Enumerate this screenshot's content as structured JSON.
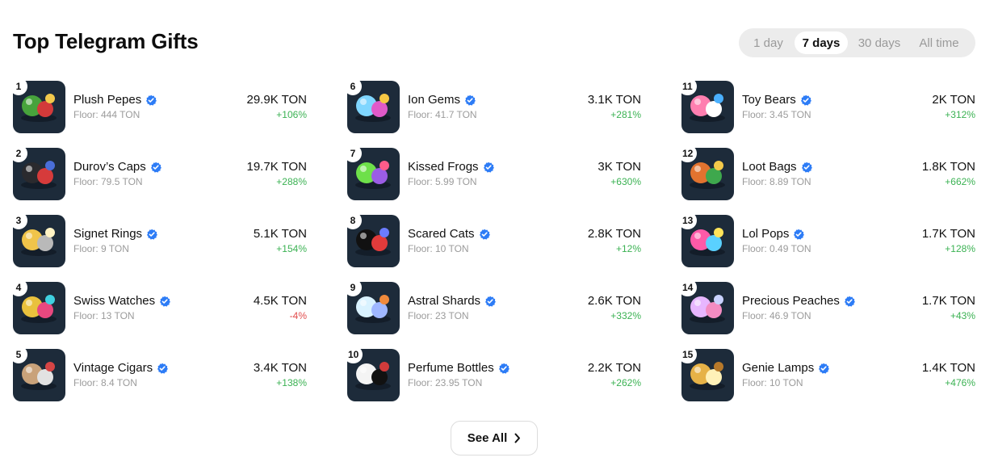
{
  "header": {
    "title": "Top Telegram Gifts"
  },
  "range": {
    "options": [
      {
        "label": "1 day",
        "active": false
      },
      {
        "label": "7 days",
        "active": true
      },
      {
        "label": "30 days",
        "active": false
      },
      {
        "label": "All time",
        "active": false
      }
    ]
  },
  "gifts": [
    {
      "rank": "1",
      "name": "Plush Pepes",
      "floor": "Floor: 444 TON",
      "volume": "29.9K TON",
      "change": "+106%",
      "trend": "up",
      "icon": "frog-plush-icon",
      "colors": [
        "#47a33c",
        "#d33a3a",
        "#f2c94c"
      ]
    },
    {
      "rank": "2",
      "name": "Durov’s Caps",
      "floor": "Floor: 79.5 TON",
      "volume": "19.7K TON",
      "change": "+288%",
      "trend": "up",
      "icon": "cap-icon",
      "colors": [
        "#2a2a2e",
        "#d63b3b",
        "#4a6ed8"
      ]
    },
    {
      "rank": "3",
      "name": "Signet Rings",
      "floor": "Floor: 9 TON",
      "volume": "5.1K TON",
      "change": "+154%",
      "trend": "up",
      "icon": "ring-icon",
      "colors": [
        "#f0c44a",
        "#b9b9b9",
        "#fff3c4"
      ]
    },
    {
      "rank": "4",
      "name": "Swiss Watches",
      "floor": "Floor: 13 TON",
      "volume": "4.5K TON",
      "change": "-4%",
      "trend": "down",
      "icon": "watch-icon",
      "colors": [
        "#e9c13d",
        "#e8487f",
        "#3fd0e0"
      ]
    },
    {
      "rank": "5",
      "name": "Vintage Cigars",
      "floor": "Floor: 8.4 TON",
      "volume": "3.4K TON",
      "change": "+138%",
      "trend": "up",
      "icon": "cigar-icon",
      "colors": [
        "#c9a27a",
        "#e2e2e2",
        "#d64545"
      ]
    },
    {
      "rank": "6",
      "name": "Ion Gems",
      "floor": "Floor: 41.7 TON",
      "volume": "3.1K TON",
      "change": "+281%",
      "trend": "up",
      "icon": "gem-icon",
      "colors": [
        "#7fd6ff",
        "#e05ac9",
        "#f6c844"
      ]
    },
    {
      "rank": "7",
      "name": "Kissed Frogs",
      "floor": "Floor: 5.99 TON",
      "volume": "3K TON",
      "change": "+630%",
      "trend": "up",
      "icon": "frog-icon",
      "colors": [
        "#6ee04a",
        "#9b5de5",
        "#ff5c8a"
      ]
    },
    {
      "rank": "8",
      "name": "Scared Cats",
      "floor": "Floor: 10 TON",
      "volume": "2.8K TON",
      "change": "+12%",
      "trend": "up",
      "icon": "cat-icon",
      "colors": [
        "#111111",
        "#e23b3b",
        "#6b7cff"
      ]
    },
    {
      "rank": "9",
      "name": "Astral Shards",
      "floor": "Floor: 23 TON",
      "volume": "2.6K TON",
      "change": "+332%",
      "trend": "up",
      "icon": "crystal-icon",
      "colors": [
        "#d9f2ff",
        "#9fb7ff",
        "#f08a3c"
      ]
    },
    {
      "rank": "10",
      "name": "Perfume Bottles",
      "floor": "Floor: 23.95 TON",
      "volume": "2.2K TON",
      "change": "+262%",
      "trend": "up",
      "icon": "perfume-icon",
      "colors": [
        "#f4f4f4",
        "#111111",
        "#d23b3b"
      ]
    },
    {
      "rank": "11",
      "name": "Toy Bears",
      "floor": "Floor: 3.45 TON",
      "volume": "2K TON",
      "change": "+312%",
      "trend": "up",
      "icon": "bear-icon",
      "colors": [
        "#ff7fb0",
        "#ffffff",
        "#4ab0ff"
      ]
    },
    {
      "rank": "12",
      "name": "Loot Bags",
      "floor": "Floor: 8.89 TON",
      "volume": "1.8K TON",
      "change": "+662%",
      "trend": "up",
      "icon": "bag-icon",
      "colors": [
        "#e2732f",
        "#3ea84d",
        "#f3c94a"
      ]
    },
    {
      "rank": "13",
      "name": "Lol Pops",
      "floor": "Floor: 0.49 TON",
      "volume": "1.7K TON",
      "change": "+128%",
      "trend": "up",
      "icon": "lollipop-icon",
      "colors": [
        "#ff5aa8",
        "#5ad1ff",
        "#ffe45a"
      ]
    },
    {
      "rank": "14",
      "name": "Precious Peaches",
      "floor": "Floor: 46.9 TON",
      "volume": "1.7K TON",
      "change": "+43%",
      "trend": "up",
      "icon": "peach-icon",
      "colors": [
        "#e7b6ff",
        "#f38cc2",
        "#c9d2ff"
      ]
    },
    {
      "rank": "15",
      "name": "Genie Lamps",
      "floor": "Floor: 10 TON",
      "volume": "1.4K TON",
      "change": "+476%",
      "trend": "up",
      "icon": "lamp-icon",
      "colors": [
        "#e6b247",
        "#fff1b8",
        "#b7792a"
      ]
    }
  ],
  "footer": {
    "see_all_label": "See All"
  }
}
